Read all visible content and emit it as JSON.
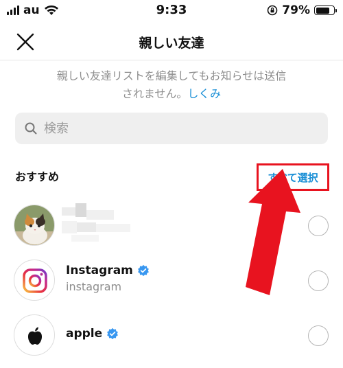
{
  "status_bar": {
    "carrier": "au",
    "time": "9:33",
    "battery": "79%",
    "battery_level": 0.79
  },
  "header": {
    "title": "親しい友達"
  },
  "notice": {
    "line1": "親しい友達リストを編集してもお知らせは送信",
    "line2": "されません。",
    "link": "しくみ"
  },
  "search": {
    "placeholder": "検索"
  },
  "section": {
    "title": "おすすめ",
    "select_all": "すべて選択"
  },
  "accounts": [
    {
      "username": "",
      "handle": "",
      "avatar": "cat-photo"
    },
    {
      "username": "Instagram",
      "handle": "instagram",
      "verified": true,
      "avatar": "instagram-logo-icon"
    },
    {
      "username": "apple",
      "handle": "",
      "verified": true,
      "avatar": "apple-logo-icon"
    }
  ],
  "colors": {
    "accent": "#1a8fd6",
    "highlight": "#e8131f",
    "muted": "#8e8e8e",
    "verified": "#3897f0"
  }
}
